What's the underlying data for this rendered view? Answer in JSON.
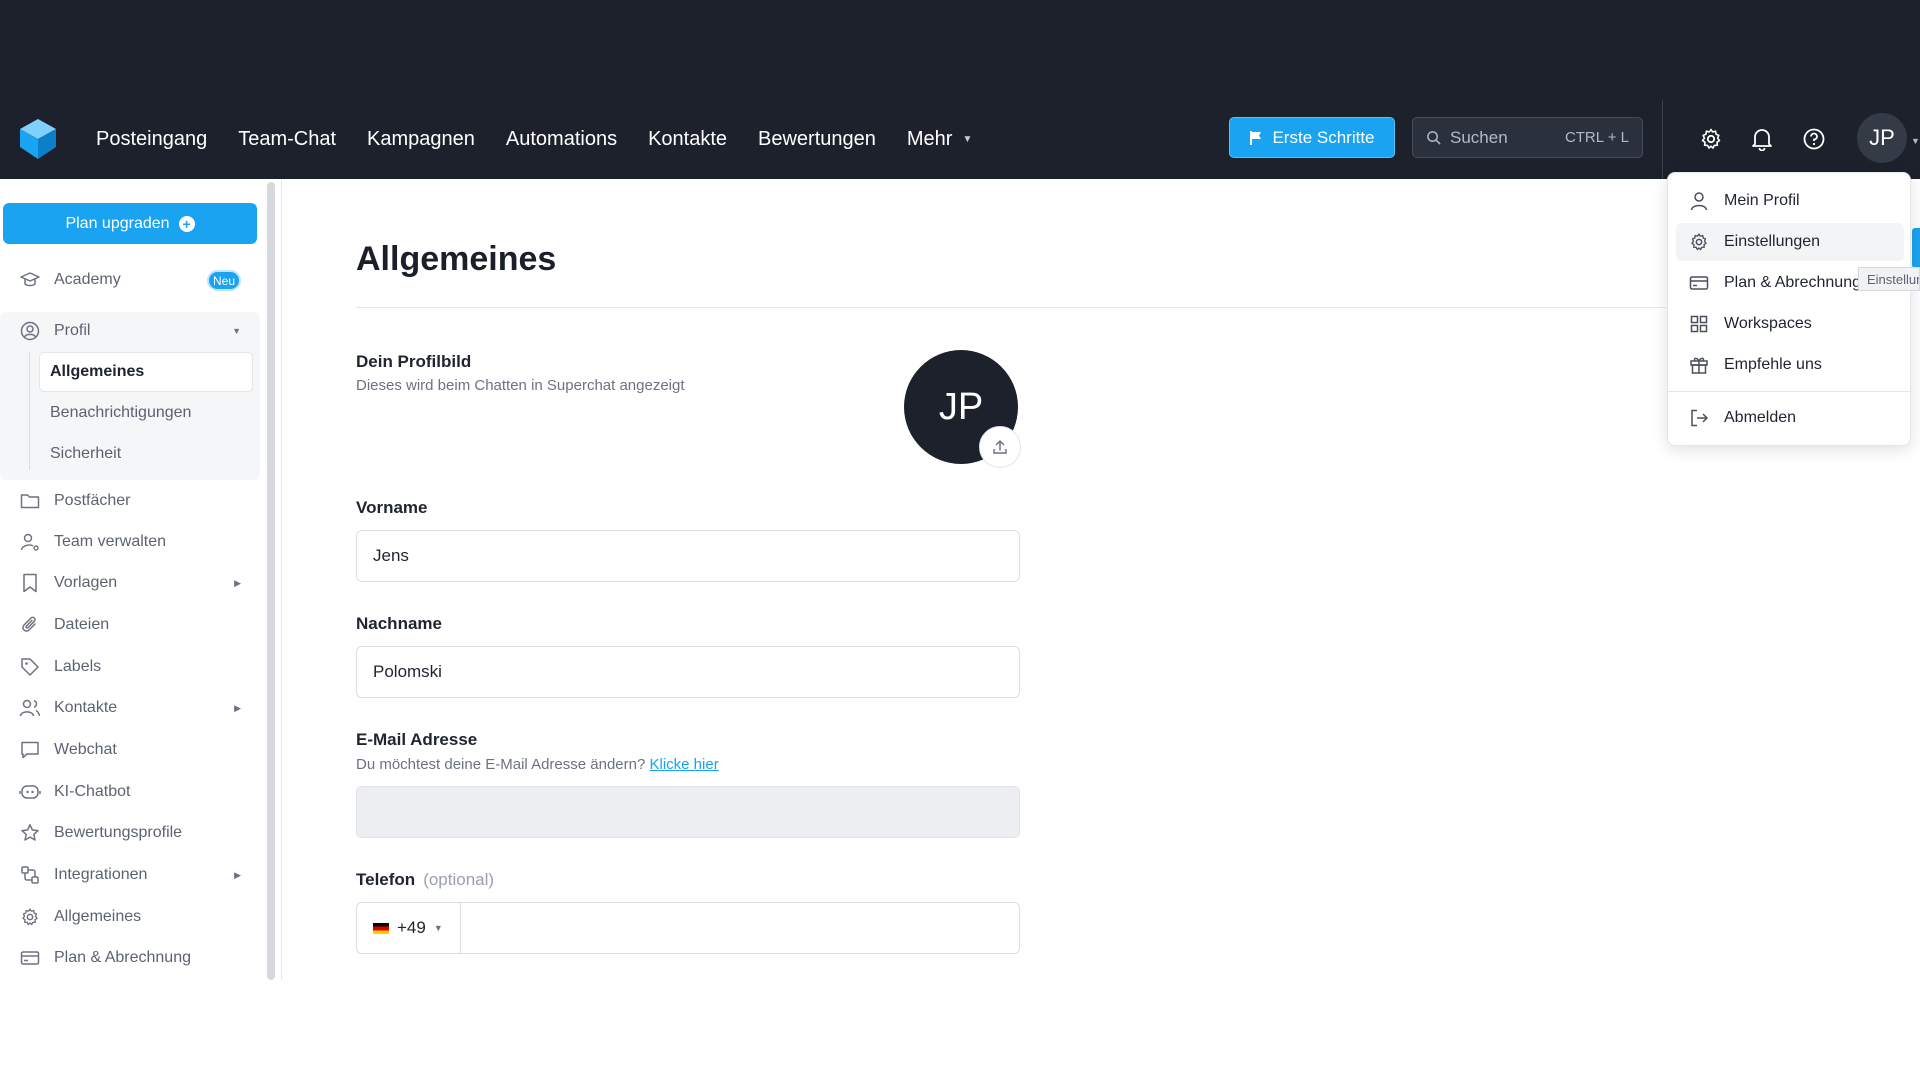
{
  "nav": {
    "items": [
      "Posteingang",
      "Team-Chat",
      "Kampagnen",
      "Automations",
      "Kontakte",
      "Bewertungen",
      "Mehr"
    ],
    "erste_schritte": "Erste Schritte",
    "search_placeholder": "Suchen",
    "search_shortcut": "CTRL + L",
    "avatar_initials": "JP"
  },
  "sidebar": {
    "plan_upgraden": "Plan upgraden",
    "academy": "Academy",
    "neu_badge": "Neu",
    "profil": "Profil",
    "profil_sub": [
      "Allgemeines",
      "Benachrichtigungen",
      "Sicherheit"
    ],
    "items": [
      "Postfächer",
      "Team verwalten",
      "Vorlagen",
      "Dateien",
      "Labels",
      "Kontakte",
      "Webchat",
      "KI-Chatbot",
      "Bewertungsprofile",
      "Integrationen",
      "Allgemeines",
      "Plan & Abrechnung"
    ]
  },
  "main": {
    "title": "Allgemeines",
    "profilbild_label": "Dein Profilbild",
    "profilbild_hint": "Dieses wird beim Chatten in Superchat angezeigt",
    "avatar_initials": "JP",
    "vorname_label": "Vorname",
    "vorname_value": "Jens",
    "nachname_label": "Nachname",
    "nachname_value": "Polomski",
    "email_label": "E-Mail Adresse",
    "email_hint": "Du möchtest deine E-Mail Adresse ändern?",
    "email_link": "Klicke hier",
    "email_value": "",
    "telefon_label": "Telefon",
    "telefon_optional": "(optional)",
    "country_code": "+49",
    "telefon_value": ""
  },
  "dropdown": {
    "items": [
      "Mein Profil",
      "Einstellungen",
      "Plan & Abrechnung",
      "Workspaces",
      "Empfehle uns"
    ],
    "logout": "Abmelden",
    "tooltip": "Einstellungen"
  },
  "colors": {
    "accent": "#1aa3f0",
    "nav_bg": "#1c212c"
  }
}
